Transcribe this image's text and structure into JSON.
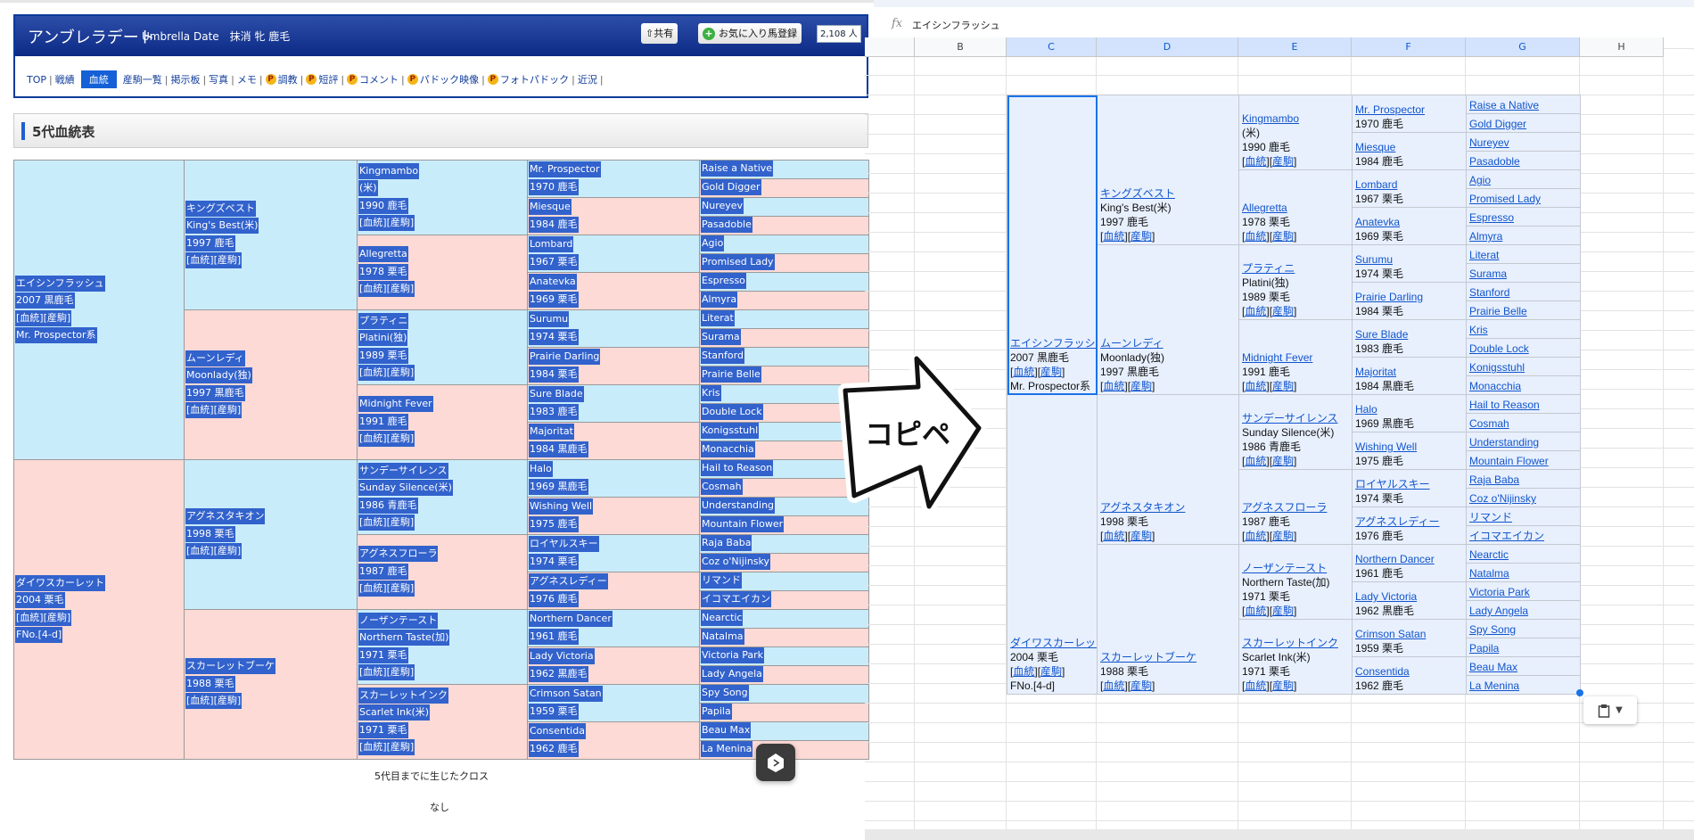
{
  "site": {
    "title": "アンブレラデート",
    "subtitle": "Umbrella Date　抹消 牝 鹿毛",
    "share_label": "共有",
    "favorite_label": "お気に入り馬登録",
    "favorite_count": "2,108 人"
  },
  "nav": [
    {
      "label": "TOP",
      "p": false,
      "active": false
    },
    {
      "label": "戦績",
      "p": false,
      "active": false
    },
    {
      "label": "血統",
      "p": false,
      "active": true
    },
    {
      "label": "産駒一覧",
      "p": false,
      "active": false
    },
    {
      "label": "掲示板",
      "p": false,
      "active": false
    },
    {
      "label": "写真",
      "p": false,
      "active": false
    },
    {
      "label": "メモ",
      "p": false,
      "active": false
    },
    {
      "label": "調教",
      "p": true,
      "active": false
    },
    {
      "label": "短評",
      "p": true,
      "active": false
    },
    {
      "label": "コメント",
      "p": true,
      "active": false
    },
    {
      "label": "パドック映像",
      "p": true,
      "active": false
    },
    {
      "label": "フォトパドック",
      "p": true,
      "active": false
    },
    {
      "label": "近況",
      "p": false,
      "active": false
    }
  ],
  "section_title": "5代血統表",
  "cross_label": "5代目までに生じたクロス",
  "cross_value": "なし",
  "link_labels": [
    "血統",
    "産駒"
  ],
  "arrow_label": "コピペ",
  "sheet": {
    "formula_value": "エイシンフラッシュ",
    "columns": [
      "B",
      "C",
      "D",
      "E",
      "F",
      "G",
      "H"
    ],
    "selected_columns": [
      "C",
      "D",
      "E",
      "F",
      "G"
    ]
  },
  "colors": {
    "sire_bg": "#c9ecfb",
    "dam_bg": "#fddad5",
    "selection": "#3262cc",
    "sheet_link": "#1155cc",
    "sheet_accent": "#1a73e8"
  },
  "pedigree": {
    "gen1": [
      {
        "name": "エイシンフラッシュ",
        "year": "2007 黒鹿毛",
        "links": true,
        "extra": "Mr. Prospector系"
      },
      {
        "name": "ダイワスカーレット",
        "year": "2004 栗毛",
        "links": true,
        "extra": "FNo.[4-d]"
      }
    ],
    "gen2": [
      {
        "name": "キングズベスト",
        "alt": "King's Best(米)",
        "year": "1997 鹿毛",
        "links": true
      },
      {
        "name": "ムーンレディ",
        "alt": "Moonlady(独)",
        "year": "1997 黒鹿毛",
        "links": true
      },
      {
        "name": "アグネスタキオン",
        "year": "1998 栗毛",
        "links": true
      },
      {
        "name": "スカーレットブーケ",
        "year": "1988 栗毛",
        "links": true
      }
    ],
    "gen3": [
      {
        "name": "Kingmambo",
        "alt": "(米)",
        "year": "1990 鹿毛",
        "links": true
      },
      {
        "name": "Allegretta",
        "year": "1978 栗毛",
        "links": true
      },
      {
        "name": "プラティニ",
        "alt": "Platini(独)",
        "year": "1989 栗毛",
        "links": true
      },
      {
        "name": "Midnight Fever",
        "year": "1991 鹿毛",
        "links": true
      },
      {
        "name": "サンデーサイレンス",
        "alt": "Sunday Silence(米)",
        "year": "1986 青鹿毛",
        "links": true
      },
      {
        "name": "アグネスフローラ",
        "year": "1987 鹿毛",
        "links": true
      },
      {
        "name": "ノーザンテースト",
        "alt": "Northern Taste(加)",
        "year": "1971 栗毛",
        "links": true
      },
      {
        "name": "スカーレットインク",
        "alt": "Scarlet Ink(米)",
        "year": "1971 栗毛",
        "links": true
      }
    ],
    "gen4": [
      {
        "name": "Mr. Prospector",
        "year": "1970 鹿毛"
      },
      {
        "name": "Miesque",
        "year": "1984 鹿毛"
      },
      {
        "name": "Lombard",
        "year": "1967 栗毛"
      },
      {
        "name": "Anatevka",
        "year": "1969 栗毛"
      },
      {
        "name": "Surumu",
        "year": "1974 栗毛"
      },
      {
        "name": "Prairie Darling",
        "year": "1984 栗毛"
      },
      {
        "name": "Sure Blade",
        "year": "1983 鹿毛"
      },
      {
        "name": "Majoritat",
        "year": "1984 黒鹿毛"
      },
      {
        "name": "Halo",
        "year": "1969 黒鹿毛"
      },
      {
        "name": "Wishing Well",
        "year": "1975 鹿毛"
      },
      {
        "name": "ロイヤルスキー",
        "year": "1974 栗毛"
      },
      {
        "name": "アグネスレディー",
        "year": "1976 鹿毛"
      },
      {
        "name": "Northern Dancer",
        "year": "1961 鹿毛"
      },
      {
        "name": "Lady Victoria",
        "year": "1962 黒鹿毛"
      },
      {
        "name": "Crimson Satan",
        "year": "1959 栗毛"
      },
      {
        "name": "Consentida",
        "year": "1962 鹿毛"
      }
    ],
    "gen5": [
      {
        "name": "Raise a Native"
      },
      {
        "name": "Gold Digger"
      },
      {
        "name": "Nureyev"
      },
      {
        "name": "Pasadoble"
      },
      {
        "name": "Agio"
      },
      {
        "name": "Promised Lady"
      },
      {
        "name": "Espresso"
      },
      {
        "name": "Almyra"
      },
      {
        "name": "Literat"
      },
      {
        "name": "Surama"
      },
      {
        "name": "Stanford"
      },
      {
        "name": "Prairie Belle"
      },
      {
        "name": "Kris"
      },
      {
        "name": "Double Lock"
      },
      {
        "name": "Konigsstuhl"
      },
      {
        "name": "Monacchia"
      },
      {
        "name": "Hail to Reason"
      },
      {
        "name": "Cosmah"
      },
      {
        "name": "Understanding"
      },
      {
        "name": "Mountain Flower"
      },
      {
        "name": "Raja Baba"
      },
      {
        "name": "Coz o'Nijinsky"
      },
      {
        "name": "リマンド"
      },
      {
        "name": "イコマエイカン"
      },
      {
        "name": "Nearctic"
      },
      {
        "name": "Natalma"
      },
      {
        "name": "Victoria Park"
      },
      {
        "name": "Lady Angela"
      },
      {
        "name": "Spy Song"
      },
      {
        "name": "Papila"
      },
      {
        "name": "Beau Max"
      },
      {
        "name": "La Menina"
      }
    ]
  }
}
